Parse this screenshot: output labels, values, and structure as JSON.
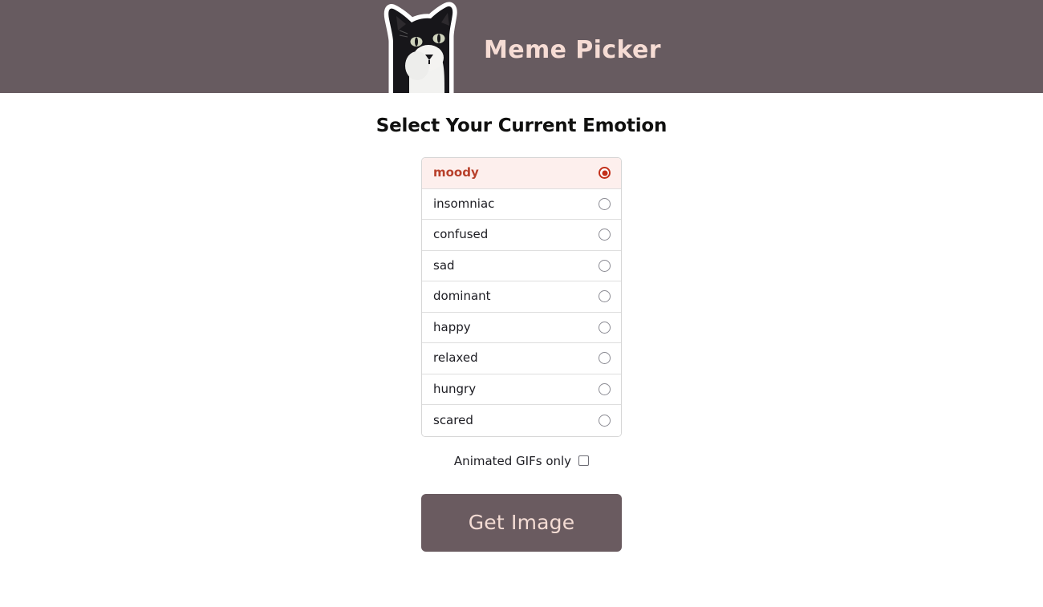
{
  "header": {
    "title": "Meme Picker",
    "logo_icon": "cat-sticker-icon",
    "background_color": "#675B60",
    "title_color": "#F6DCD4"
  },
  "main": {
    "page_title": "Select Your Current Emotion",
    "emotions": [
      {
        "label": "moody",
        "selected": true
      },
      {
        "label": "insomniac",
        "selected": false
      },
      {
        "label": "confused",
        "selected": false
      },
      {
        "label": "sad",
        "selected": false
      },
      {
        "label": "dominant",
        "selected": false
      },
      {
        "label": "happy",
        "selected": false
      },
      {
        "label": "relaxed",
        "selected": false
      },
      {
        "label": "hungry",
        "selected": false
      },
      {
        "label": "scared",
        "selected": false
      }
    ],
    "gif_filter": {
      "label": "Animated GIFs only",
      "checked": false
    },
    "submit_label": "Get Image"
  },
  "colors": {
    "accent": "#C3301B",
    "selected_row_bg": "#FDEFED",
    "selected_row_text": "#B8402B",
    "button_bg": "#6A5B60",
    "button_text": "#F4DCD4",
    "border": "#d6d6d6"
  }
}
